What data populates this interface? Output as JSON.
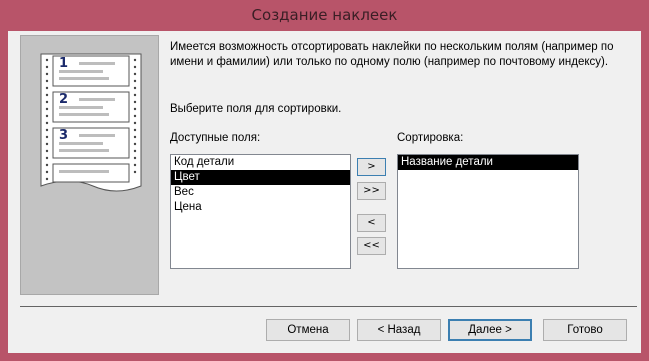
{
  "window": {
    "title": "Создание наклеек",
    "chrome_color": "#b85469"
  },
  "illustration": {
    "label_numbers": [
      "1",
      "2",
      "3"
    ]
  },
  "description": "Имеется возможность отсортировать наклейки по нескольким полям (например по имени и фамилии) или только по одному полю (например по почтовому индексу).",
  "prompt": "Выберите поля для сортировки.",
  "available_fields": {
    "label": "Доступные поля:",
    "items": [
      "Код детали",
      "Цвет",
      "Вес",
      "Цена"
    ],
    "selected_index": 1
  },
  "sort_fields": {
    "label": "Сортировка:",
    "items": [
      "Название детали"
    ],
    "selected_index": 0
  },
  "move_buttons": {
    "add": ">",
    "add_all": ">>",
    "remove": "<",
    "remove_all": "<<"
  },
  "footer": {
    "cancel": "Отмена",
    "back": "< Назад",
    "next": "Далее >",
    "finish": "Готово"
  }
}
